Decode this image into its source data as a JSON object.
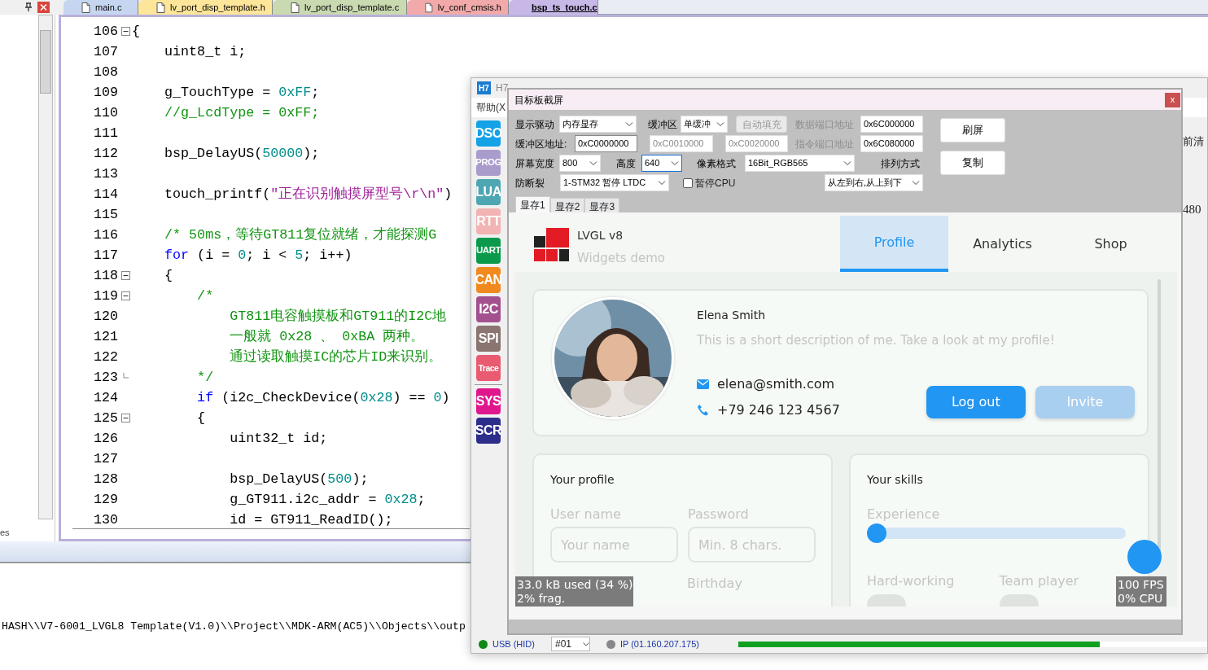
{
  "ide": {
    "tabs": [
      {
        "label": "main.c",
        "color": "#c6d6f0",
        "selected": false
      },
      {
        "label": "lv_port_disp_template.h",
        "color": "#fde59a",
        "selected": false
      },
      {
        "label": "lv_port_disp_template.c",
        "color": "#c9d9b0",
        "selected": false
      },
      {
        "label": "lv_conf_cmsis.h",
        "color": "#f1a9a9",
        "selected": false
      },
      {
        "label": "bsp_ts_touch.c",
        "color": "#c8b8e8",
        "selected": true
      }
    ],
    "side_panel_label": "es",
    "code_lines": [
      {
        "number": "106",
        "fold_start": true,
        "parts": [
          {
            "kind": "plain",
            "text": "{"
          }
        ]
      },
      {
        "number": "107",
        "parts": [
          {
            "kind": "plain",
            "text": "    uint8_t i;"
          }
        ]
      },
      {
        "number": "108"
      },
      {
        "number": "109",
        "parts": [
          {
            "kind": "plain",
            "text": "    g_TouchType = "
          },
          {
            "kind": "number",
            "text": "0xFF"
          },
          {
            "kind": "plain",
            "text": ";"
          }
        ]
      },
      {
        "number": "110",
        "parts": [
          {
            "kind": "comment",
            "text": "    //g_LcdType = 0xFF;"
          }
        ]
      },
      {
        "number": "111"
      },
      {
        "number": "112",
        "parts": [
          {
            "kind": "plain",
            "text": "    bsp_DelayUS("
          },
          {
            "kind": "number",
            "text": "50000"
          },
          {
            "kind": "plain",
            "text": ");"
          }
        ]
      },
      {
        "number": "113"
      },
      {
        "number": "114",
        "parts": [
          {
            "kind": "plain",
            "text": "    touch_printf("
          },
          {
            "kind": "string",
            "text": "\"正在识别触摸屏型号\\r\\n\""
          },
          {
            "kind": "plain",
            "text": ")"
          }
        ]
      },
      {
        "number": "115"
      },
      {
        "number": "116",
        "parts": [
          {
            "kind": "comment",
            "text": "    /* 50ms，等待GT811复位就绪，才能探测G"
          }
        ]
      },
      {
        "number": "117",
        "parts": [
          {
            "kind": "keyword",
            "text": "    for"
          },
          {
            "kind": "plain",
            "text": " (i = "
          },
          {
            "kind": "number",
            "text": "0"
          },
          {
            "kind": "plain",
            "text": "; i < "
          },
          {
            "kind": "number",
            "text": "5"
          },
          {
            "kind": "plain",
            "text": "; i++)"
          }
        ]
      },
      {
        "number": "118",
        "fold_start": true,
        "parts": [
          {
            "kind": "plain",
            "text": "    {"
          }
        ]
      },
      {
        "number": "119",
        "fold_start": true,
        "parts": [
          {
            "kind": "comment",
            "text": "        /*"
          }
        ]
      },
      {
        "number": "120",
        "parts": [
          {
            "kind": "comment",
            "text": "            GT811电容触摸板和GT911的I2C地"
          }
        ]
      },
      {
        "number": "121",
        "parts": [
          {
            "kind": "comment",
            "text": "            一般就 0x28 、 0xBA 两种。"
          }
        ]
      },
      {
        "number": "122",
        "parts": [
          {
            "kind": "comment",
            "text": "            通过读取触摸IC的芯片ID来识别。"
          }
        ]
      },
      {
        "number": "123",
        "fold_end": true,
        "parts": [
          {
            "kind": "comment",
            "text": "        */"
          }
        ]
      },
      {
        "number": "124",
        "parts": [
          {
            "kind": "keyword",
            "text": "        if"
          },
          {
            "kind": "plain",
            "text": " (i2c_CheckDevice("
          },
          {
            "kind": "number",
            "text": "0x28"
          },
          {
            "kind": "plain",
            "text": ") == "
          },
          {
            "kind": "number",
            "text": "0"
          },
          {
            "kind": "plain",
            "text": ")"
          }
        ]
      },
      {
        "number": "125",
        "fold_start": true,
        "parts": [
          {
            "kind": "plain",
            "text": "        {"
          }
        ]
      },
      {
        "number": "126",
        "parts": [
          {
            "kind": "plain",
            "text": "            uint32_t id;"
          }
        ]
      },
      {
        "number": "127"
      },
      {
        "number": "128",
        "parts": [
          {
            "kind": "plain",
            "text": "            bsp_DelayUS("
          },
          {
            "kind": "number",
            "text": "500"
          },
          {
            "kind": "plain",
            "text": ");"
          }
        ]
      },
      {
        "number": "129",
        "parts": [
          {
            "kind": "plain",
            "text": "            g_GT911.i2c_addr = "
          },
          {
            "kind": "number",
            "text": "0x28"
          },
          {
            "kind": "plain",
            "text": ";"
          }
        ]
      },
      {
        "number": "130",
        "parts": [
          {
            "kind": "plain",
            "text": "            id = GT911_ReadID();"
          }
        ]
      }
    ],
    "output_line": "HASH\\\\V7-6001_LVGL8 Template(V1.0)\\\\Project\\\\MDK-ARM(AC5)\\\\Objects\\\\outp"
  },
  "tool_window": {
    "icon_label": "H7",
    "title": "H7",
    "menu": "帮助(X",
    "side_buttons": [
      {
        "label": "DSO",
        "color": "#13a2e6",
        "separator_before": false
      },
      {
        "label": "PROG",
        "color": "#a99ccd",
        "separator_before": false
      },
      {
        "label": "LUA",
        "color": "#4fa6b3",
        "separator_before": false
      },
      {
        "label": "RTT",
        "color": "#f2b3b3",
        "separator_before": false
      },
      {
        "label": "UART",
        "color": "#0b9a4b",
        "separator_before": false
      },
      {
        "label": "CAN",
        "color": "#f18a1e",
        "separator_before": false
      },
      {
        "label": "I2C",
        "color": "#a3508f",
        "separator_before": false
      },
      {
        "label": "SPI",
        "color": "#8a7570",
        "separator_before": false
      },
      {
        "label": "Trace",
        "color": "#e85b70",
        "separator_before": false
      },
      {
        "label": "SYS",
        "color": "#e0168d",
        "separator_before": true
      },
      {
        "label": "SCR",
        "color": "#2d2d8a",
        "separator_before": false
      }
    ],
    "behind_texts": [
      "前清",
      "480"
    ],
    "status": {
      "usb": "USB (HID)",
      "device": "#01",
      "ip": "IP (01.160.207.175)",
      "progress": {
        "level": 0.77
      }
    }
  },
  "dialog": {
    "title": "目标板截屏",
    "close_label": "x",
    "rows": [
      {
        "items": [
          {
            "kind": "label",
            "text": "显示驱动",
            "disabled": false
          },
          {
            "kind": "select",
            "value": "内存显存"
          },
          {
            "kind": "label",
            "text": "缓冲区",
            "disabled": false
          },
          {
            "kind": "select",
            "value": "单缓冲"
          },
          {
            "kind": "button",
            "text": "自动填充",
            "disabled": true
          },
          {
            "kind": "label",
            "text": "数据端口地址",
            "disabled": true
          },
          {
            "kind": "input",
            "value": "0x6C000000",
            "disabled": false,
            "focused": false
          }
        ]
      },
      {
        "items": [
          {
            "kind": "label",
            "text": "缓冲区地址:",
            "disabled": false
          },
          {
            "kind": "input",
            "value": "0xC0000000",
            "disabled": false,
            "focused": true
          },
          {
            "kind": "input",
            "value": "0xC0010000",
            "disabled": true,
            "focused": false
          },
          {
            "kind": "input",
            "value": "0xC0020000",
            "disabled": true,
            "focused": false
          },
          {
            "kind": "label",
            "text": "指令端口地址",
            "disabled": true
          },
          {
            "kind": "input",
            "value": "0x6C080000",
            "disabled": false,
            "focused": false
          }
        ]
      },
      {
        "items": [
          {
            "kind": "label",
            "text": "屏幕宽度",
            "disabled": false
          },
          {
            "kind": "select",
            "value": "800"
          },
          {
            "kind": "label",
            "text": "高度",
            "disabled": false
          },
          {
            "kind": "select",
            "value": "640",
            "focused": true
          },
          {
            "kind": "label",
            "text": "像素格式",
            "disabled": false
          },
          {
            "kind": "select",
            "value": "16Bit_RGB565"
          },
          {
            "kind": "label",
            "text": "排列方式",
            "disabled": false
          }
        ]
      },
      {
        "items": [
          {
            "kind": "label",
            "text": "防断裂",
            "disabled": false
          },
          {
            "kind": "select",
            "value": "1-STM32 暂停 LTDC"
          },
          {
            "kind": "checkbox",
            "label": "暂停CPU",
            "checked": false
          },
          {
            "kind": "select",
            "value": "从左到右,从上到下"
          }
        ]
      }
    ],
    "buttons": [
      "刷屏",
      "复制"
    ],
    "tabs": [
      {
        "label": "显存1",
        "selected": true
      },
      {
        "label": "显存2",
        "selected": false
      },
      {
        "label": "显存3",
        "selected": false
      }
    ],
    "screen": {
      "app_title": "LVGL v8",
      "app_subtitle": "Widgets demo",
      "tabs": [
        {
          "label": "Profile",
          "selected": true
        },
        {
          "label": "Analytics",
          "selected": false
        },
        {
          "label": "Shop",
          "selected": false
        }
      ],
      "profile_card": {
        "name": "Elena Smith",
        "description": "This is a short description of me. Take a look at my profile!",
        "email": "elena@smith.com",
        "phone": "+79 246 123 4567",
        "buttons": [
          {
            "label": "Log out",
            "disabled": false
          },
          {
            "label": "Invite",
            "disabled": true
          }
        ]
      },
      "profile_form": {
        "title": "Your profile",
        "fields": [
          {
            "label": "User name",
            "placeholder": "Your name"
          },
          {
            "label": "Password",
            "placeholder": "Min. 8 chars."
          }
        ],
        "next_label": "Birthday"
      },
      "skills": {
        "title": "Your skills",
        "slider": {
          "label": "Experience",
          "level": 0
        },
        "switches": [
          {
            "label": "Hard-working",
            "on": false
          },
          {
            "label": "Team player",
            "on": false
          }
        ]
      },
      "memory_monitor": [
        "33.0 kB used (34 %)",
        "2% frag."
      ],
      "perf_monitor": [
        "100 FPS",
        "0% CPU"
      ]
    }
  }
}
